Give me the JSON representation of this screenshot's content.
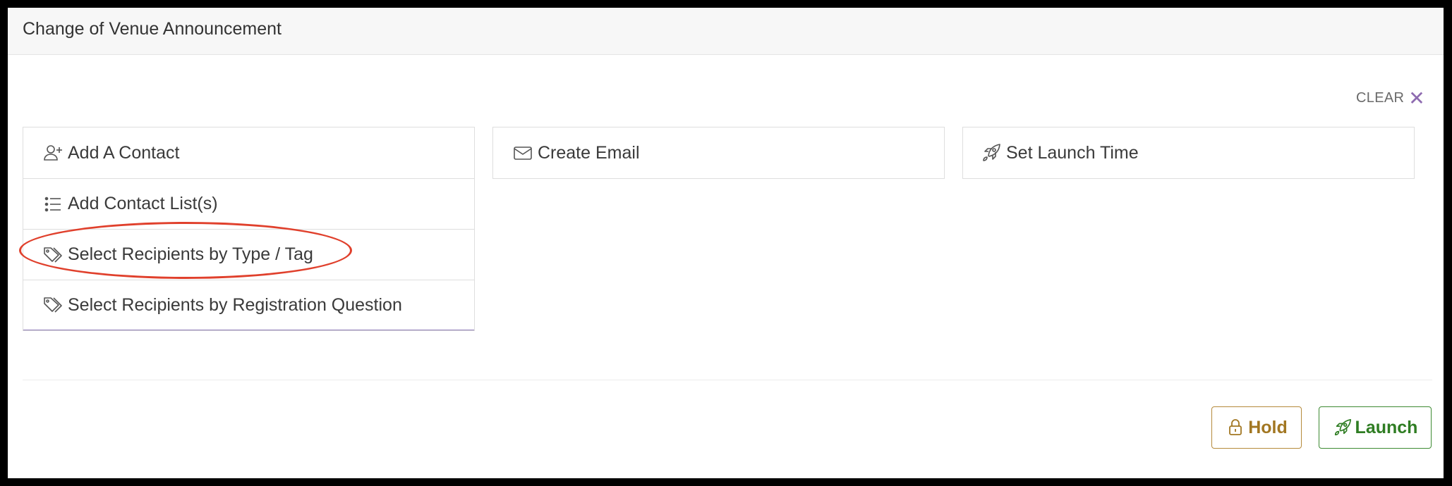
{
  "header": {
    "title": "Change of Venue Announcement"
  },
  "toolbar": {
    "clear_label": "CLEAR",
    "clear_icon": "close-icon"
  },
  "recipients": {
    "items": [
      {
        "label": "Add A Contact",
        "icon": "user-plus-icon"
      },
      {
        "label": "Add Contact List(s)",
        "icon": "list-icon"
      },
      {
        "label": "Select Recipients by Type / Tag",
        "icon": "tags-icon"
      },
      {
        "label": "Select Recipients by Registration Question",
        "icon": "tags-icon"
      }
    ]
  },
  "email_panel": {
    "label": "Create Email",
    "icon": "envelope-icon"
  },
  "launch_panel": {
    "label": "Set Launch Time",
    "icon": "rocket-icon"
  },
  "actions": {
    "hold_label": "Hold",
    "launch_label": "Launch"
  },
  "colors": {
    "accent_purple": "#8e6bb0",
    "hold": "#a27722",
    "launch": "#2f7d23",
    "highlight_ellipse": "#e0402c"
  }
}
